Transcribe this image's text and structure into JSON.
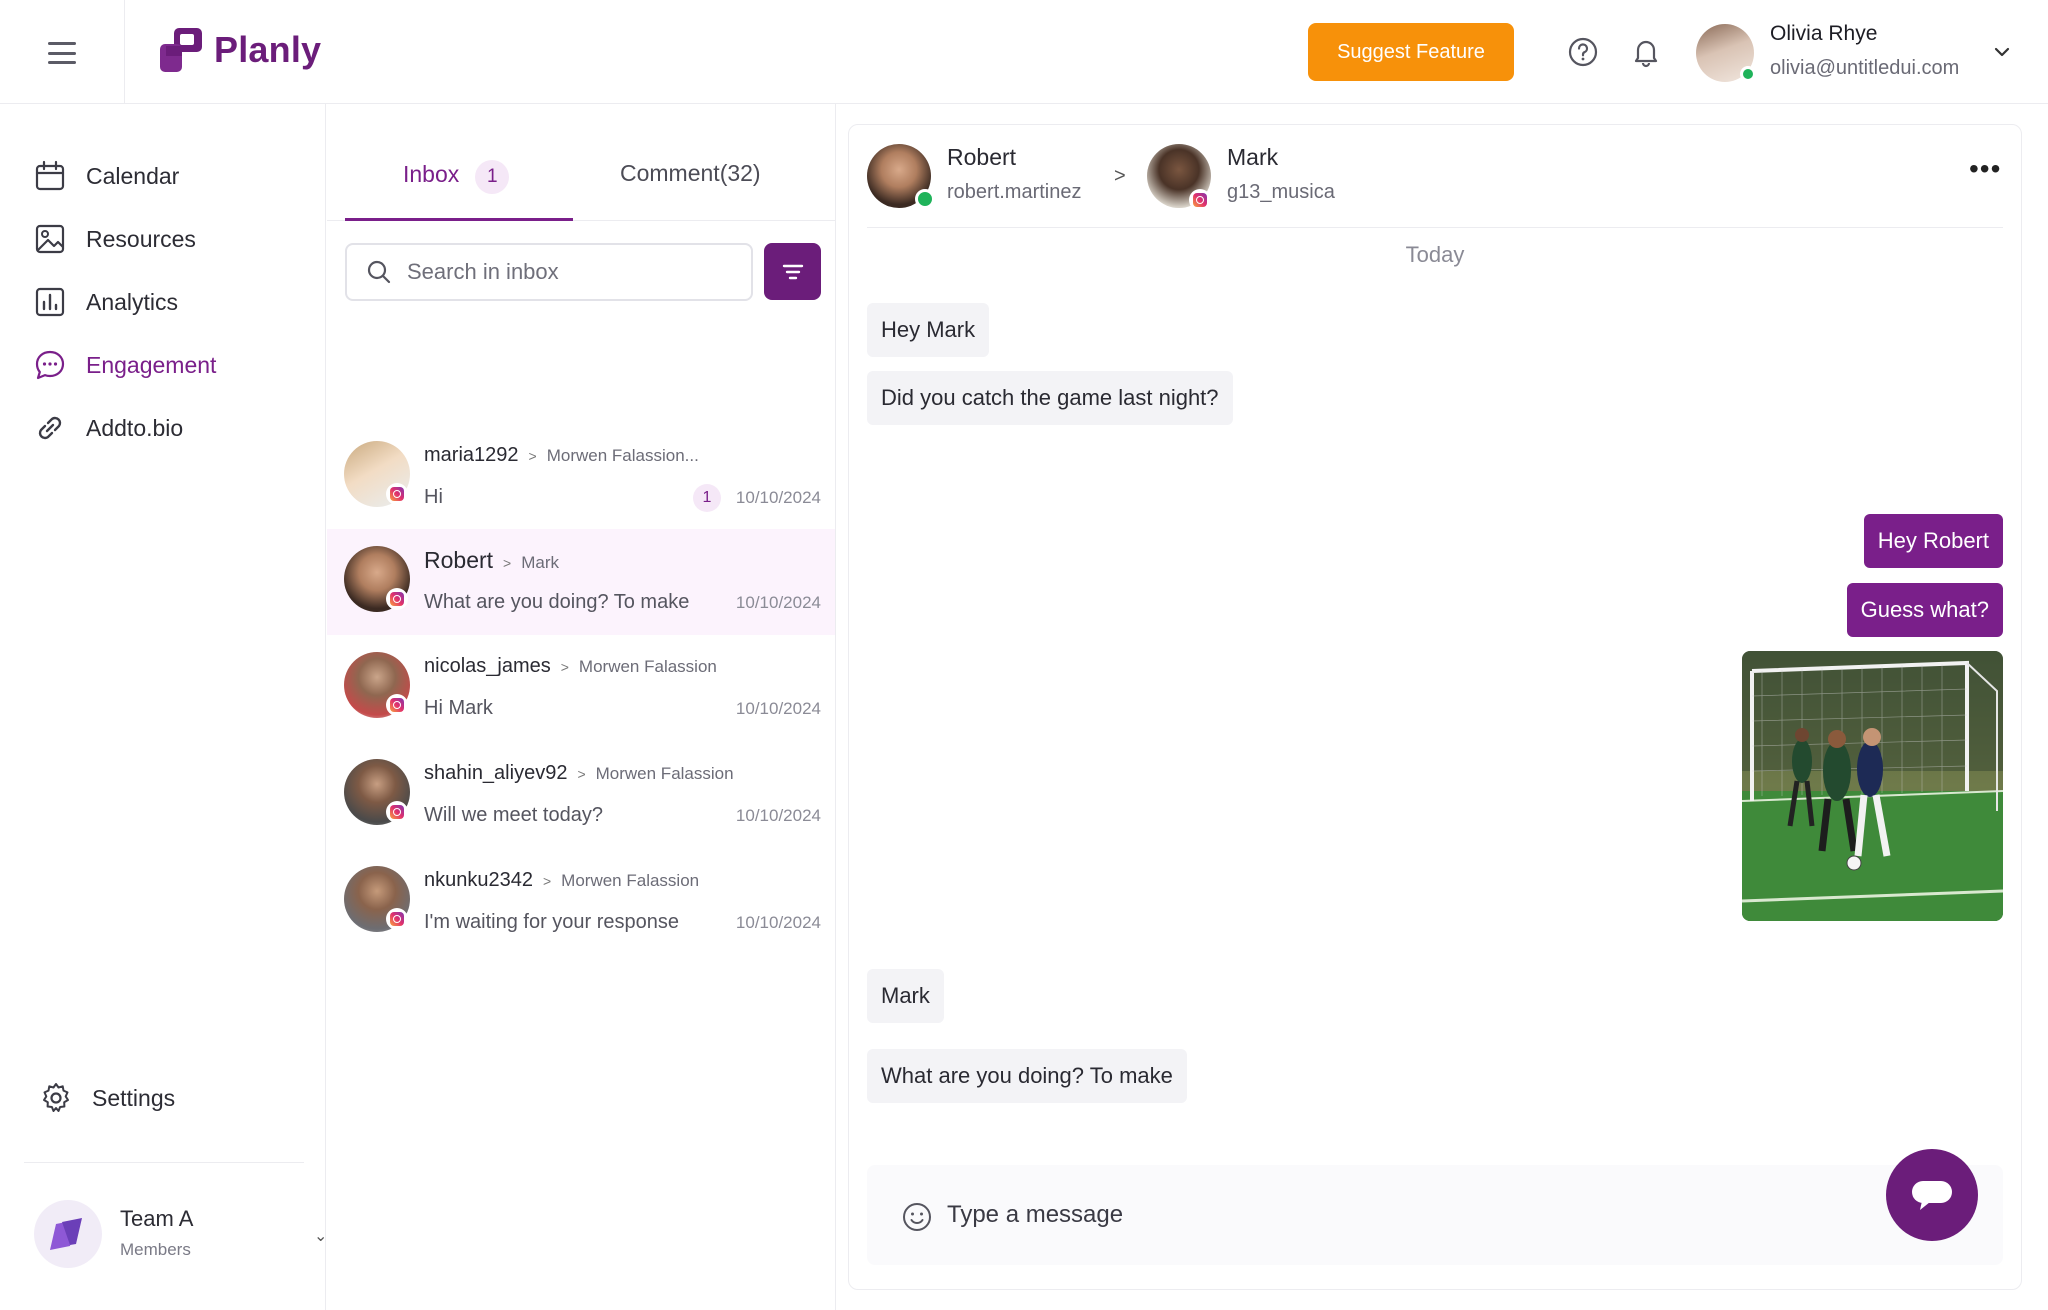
{
  "app": {
    "name": "Planly"
  },
  "header": {
    "suggest_label": "Suggest Feature",
    "user": {
      "name": "Olivia Rhye",
      "email": "olivia@untitledui.com"
    }
  },
  "sidebar": {
    "items": [
      {
        "label": "Calendar",
        "icon": "calendar-icon"
      },
      {
        "label": "Resources",
        "icon": "image-icon"
      },
      {
        "label": "Analytics",
        "icon": "bar-chart-icon"
      },
      {
        "label": "Engagement",
        "icon": "chat-bubble-icon",
        "active": true
      },
      {
        "label": "Addto.bio",
        "icon": "link-icon"
      }
    ],
    "settings_label": "Settings",
    "team": {
      "name": "Team A",
      "sub": "Members"
    }
  },
  "inbox": {
    "tabs": {
      "inbox_label": "Inbox",
      "inbox_count": "1",
      "comment_label": "Comment(32)"
    },
    "search_placeholder": "Search in inbox",
    "conversations": [
      {
        "name": "maria1292",
        "target": "Morwen Falassion...",
        "message": "Hi",
        "date": "10/10/2024",
        "unread": "1"
      },
      {
        "name": "Robert",
        "target": "Mark",
        "message": "What are you doing? To make",
        "date": "10/10/2024"
      },
      {
        "name": "nicolas_james",
        "target": "Morwen Falassion",
        "message": "Hi Mark",
        "date": "10/10/2024"
      },
      {
        "name": "shahin_aliyev92",
        "target": "Morwen Falassion",
        "message": "Will we meet today?",
        "date": "10/10/2024"
      },
      {
        "name": "nkunku2342",
        "target": "Morwen Falassion",
        "message": "I'm waiting for your response",
        "date": "10/10/2024"
      }
    ]
  },
  "chat": {
    "from": {
      "name": "Robert",
      "handle": "robert.martinez"
    },
    "to": {
      "name": "Mark",
      "handle": "g13_musica"
    },
    "day_label": "Today",
    "messages": {
      "in1": "Hey Mark",
      "in2": "Did you catch the game last night?",
      "out1": "Hey Robert",
      "out2": "Guess what?",
      "in3": "Mark",
      "in4": "What are you doing? To make"
    },
    "composer_placeholder": "Type a message"
  },
  "colors": {
    "brand": "#6b1d7a",
    "accent": "#f7910a",
    "online": "#1fb35a"
  }
}
